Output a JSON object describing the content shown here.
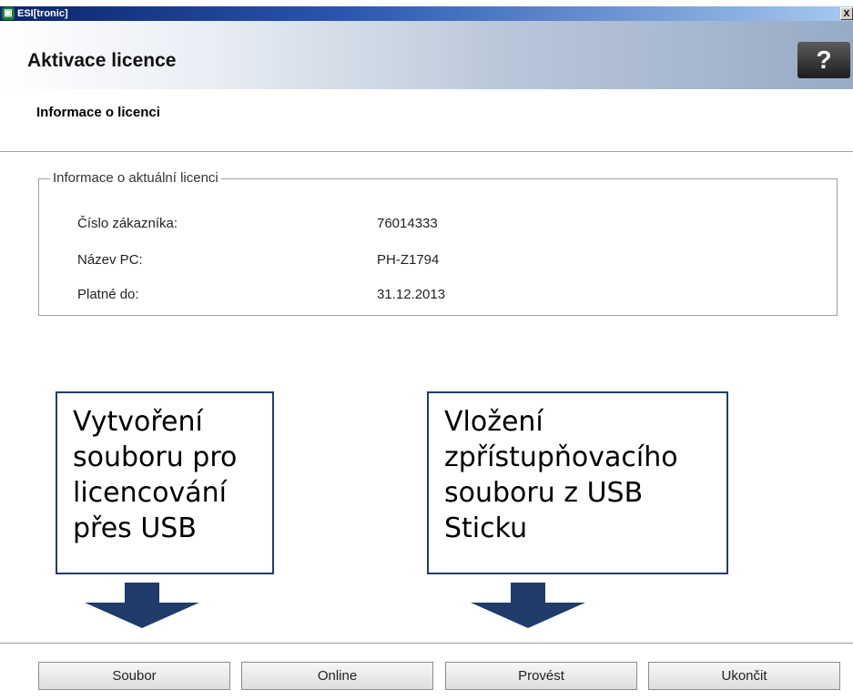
{
  "window": {
    "title": "ESI[tronic]",
    "close_glyph": "X",
    "icon": "esitronic-app-icon"
  },
  "header": {
    "title": "Aktivace licence",
    "help_label": "?"
  },
  "subheader": {
    "title": "Informace o licenci"
  },
  "license_info": {
    "legend": "Informace o aktuální licenci",
    "rows": [
      {
        "label": "Číslo zákazníka:",
        "value": "76014333"
      },
      {
        "label": "Název PC:",
        "value": "PH-Z1794"
      },
      {
        "label": "Platné do:",
        "value": "31.12.2013"
      }
    ]
  },
  "callouts": [
    {
      "lines": [
        "Vytvoření",
        "souboru pro",
        "licencování",
        "přes USB"
      ]
    },
    {
      "lines": [
        "Vložení",
        "zpřístupňovacího",
        "souboru z USB",
        "Sticku"
      ]
    }
  ],
  "buttons": {
    "file": "Soubor",
    "online": "Online",
    "execute": "Provést",
    "exit": "Ukončit"
  },
  "colors": {
    "callout_border": "#243b73",
    "arrow": "#1f3c6a"
  }
}
